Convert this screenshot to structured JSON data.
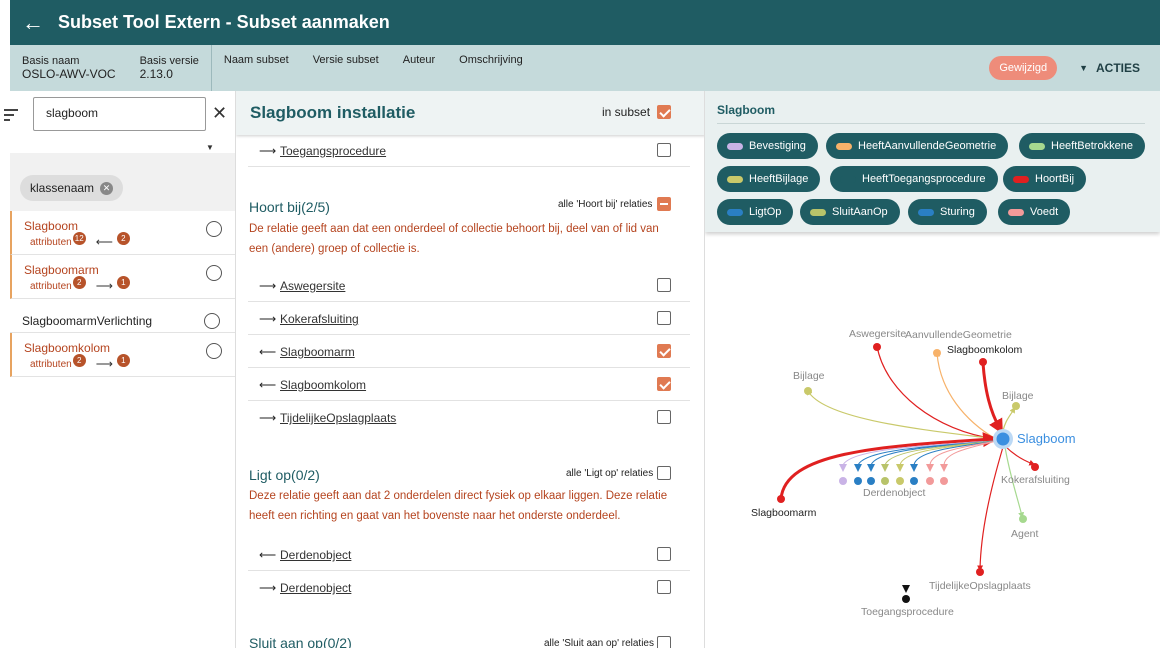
{
  "header": {
    "back_icon": "arrow-left-icon",
    "title": "Subset Tool Extern - Subset aanmaken"
  },
  "subheader": {
    "basis_naam_label": "Basis naam",
    "basis_naam_value": "OSLO-AWV-VOC",
    "basis_versie_label": "Basis versie",
    "basis_versie_value": "2.13.0",
    "naam_subset": "Naam subset",
    "versie_subset": "Versie subset",
    "auteur": "Auteur",
    "omschrijving": "Omschrijving",
    "status": "Gewijzigd",
    "acties": "ACTIES"
  },
  "left": {
    "search_value": "slagboom",
    "chip": "klassenaam",
    "items": [
      {
        "name": "Slagboom",
        "attr": "attributen",
        "attr_count": "12",
        "rel_count": "2",
        "arrow": "⟵"
      },
      {
        "name": "Slagboomarm",
        "attr": "attributen",
        "attr_count": "2",
        "rel_count": "1",
        "arrow": "⟶"
      },
      {
        "name": "SlagboomarmVerlichting"
      },
      {
        "name": "Slagboomkolom",
        "attr": "attributen",
        "attr_count": "2",
        "rel_count": "1",
        "arrow": "⟶"
      }
    ]
  },
  "middle": {
    "title": "Slagboom installatie",
    "in_subset": "in subset",
    "top_row": {
      "arrow": "⟶",
      "name": "Toegangsprocedure"
    },
    "sections": [
      {
        "title": "Hoort bij(2/5)",
        "all_label": "alle 'Hoort bij' relaties",
        "desc": "De relatie geeft aan dat een onderdeel of collectie behoort bij, deel van of lid van een (andere) groep of collectie is.",
        "rows": [
          {
            "arrow": "⟶",
            "name": "Aswegersite",
            "checked": false
          },
          {
            "arrow": "⟶",
            "name": "Kokerafsluiting",
            "checked": false
          },
          {
            "arrow": "⟵",
            "name": "Slagboomarm",
            "checked": true
          },
          {
            "arrow": "⟵",
            "name": "Slagboomkolom",
            "checked": true
          },
          {
            "arrow": "⟶",
            "name": "TijdelijkeOpslagplaats",
            "checked": false
          }
        ]
      },
      {
        "title": "Ligt op(0/2)",
        "all_label": "alle 'Ligt op' relaties",
        "desc": "Deze relatie geeft aan dat 2 onderdelen direct fysiek op elkaar liggen. Deze relatie heeft een richting en gaat van het bovenste naar het onderste onderdeel.",
        "rows": [
          {
            "arrow": "⟵",
            "name": "Derdenobject",
            "checked": false
          },
          {
            "arrow": "⟶",
            "name": "Derdenobject",
            "checked": false
          }
        ]
      },
      {
        "title": "Sluit aan op(0/2)",
        "all_label": "alle 'Sluit aan op' relaties"
      }
    ]
  },
  "right": {
    "title": "Slagboom",
    "chips": [
      {
        "label": "Bevestiging",
        "color": "#c9b3e6"
      },
      {
        "label": "HeeftAanvullendeGeometrie",
        "color": "#f7b26a"
      },
      {
        "label": "HeeftBetrokkene",
        "color": "#a6d98f"
      },
      {
        "label": "HeeftBijlage",
        "color": "#c9c96a"
      },
      {
        "label": "HeeftToegangsprocedure",
        "color": "#1f5c63"
      },
      {
        "label": "HoortBij",
        "color": "#e02020"
      },
      {
        "label": "LigtOp",
        "color": "#2a7fc4"
      },
      {
        "label": "SluitAanOp",
        "color": "#b8c36a"
      },
      {
        "label": "Sturing",
        "color": "#2a7fc4"
      },
      {
        "label": "Voedt",
        "color": "#f29a9a"
      }
    ],
    "graph": {
      "center": "Slagboom",
      "nodes": [
        "Aswegersite",
        "AanvullendeGeometrie",
        "Slagboomkolom",
        "Bijlage",
        "Bijlage",
        "Derdenobject",
        "Kokerafsluiting",
        "Agent",
        "Slagboomarm",
        "TijdelijkeOpslagplaats",
        "Toegangsprocedure"
      ]
    }
  }
}
